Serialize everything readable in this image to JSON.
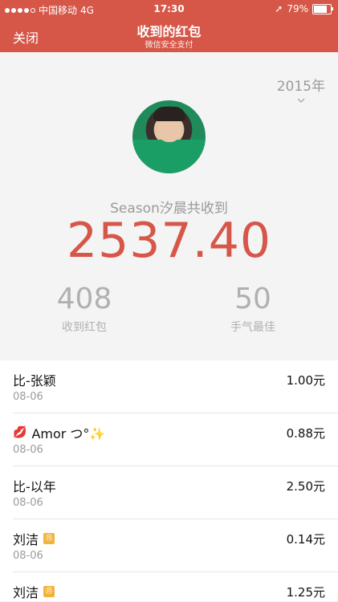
{
  "status": {
    "carrier": "中国移动",
    "network": "4G",
    "time": "17:30",
    "battery": "79%"
  },
  "navbar": {
    "close": "关闭",
    "title": "收到的红包",
    "subtitle": "微信安全支付"
  },
  "summary": {
    "year": "2015年",
    "received_label": "Season汐晨共收到",
    "amount": "2537.40",
    "count": "408",
    "count_label": "收到红包",
    "best_luck": "50",
    "best_luck_label": "手气最佳"
  },
  "items": [
    {
      "name": "比-张颖",
      "date": "08-06",
      "value": "1.00元"
    },
    {
      "name": "Amor つ°✨",
      "date": "08-06",
      "value": "0.88元"
    },
    {
      "name": "比-以年",
      "date": "08-06",
      "value": "2.50元"
    },
    {
      "name": "刘洁",
      "date": "08-06",
      "value": "0.14元"
    },
    {
      "name": "刘洁",
      "date": "",
      "value": "1.25元"
    }
  ],
  "colors": {
    "accent": "#d65748",
    "muted": "#9a9a9a",
    "tag": "#f3b23a"
  }
}
